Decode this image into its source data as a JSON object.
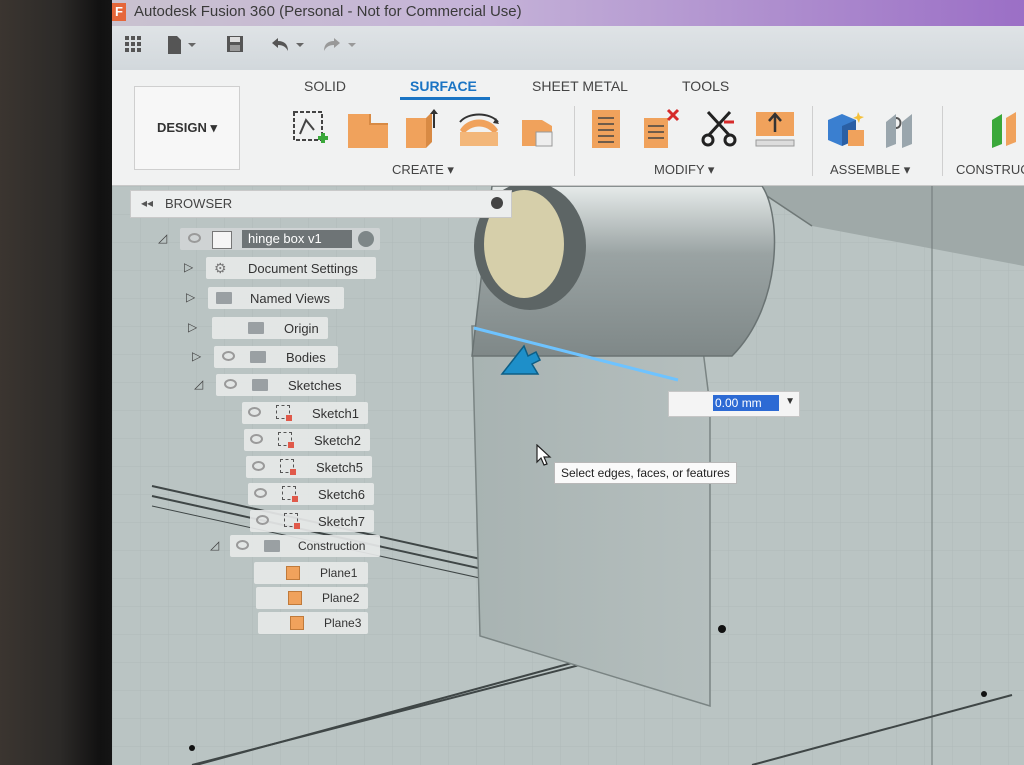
{
  "window": {
    "title": "Autodesk Fusion 360 (Personal - Not for Commercial Use)",
    "badge": "F"
  },
  "ribbon": {
    "workspace": "DESIGN ▾",
    "tabs": [
      {
        "label": "SOLID"
      },
      {
        "label": "SURFACE",
        "active": true
      },
      {
        "label": "SHEET METAL"
      },
      {
        "label": "TOOLS"
      }
    ],
    "groups": {
      "create": "CREATE ▾",
      "modify": "MODIFY ▾",
      "assemble": "ASSEMBLE ▾",
      "construct": "CONSTRUC"
    }
  },
  "browser": {
    "title": "BROWSER",
    "root": "hinge box v1",
    "items": {
      "document_settings": "Document Settings",
      "named_views": "Named Views",
      "origin": "Origin",
      "bodies": "Bodies",
      "sketches": "Sketches",
      "sketch1": "Sketch1",
      "sketch2": "Sketch2",
      "sketch5": "Sketch5",
      "sketch6": "Sketch6",
      "sketch7": "Sketch7",
      "construction": "Construction",
      "plane1": "Plane1",
      "plane2": "Plane2",
      "plane3": "Plane3"
    }
  },
  "dimension_input": {
    "value": "0.00 mm"
  },
  "tooltip": {
    "text": "Select edges, faces, or features"
  },
  "colors": {
    "accent": "#1a74c4",
    "tool_orange": "#f0a25c",
    "selection": "#2d6ad4"
  }
}
